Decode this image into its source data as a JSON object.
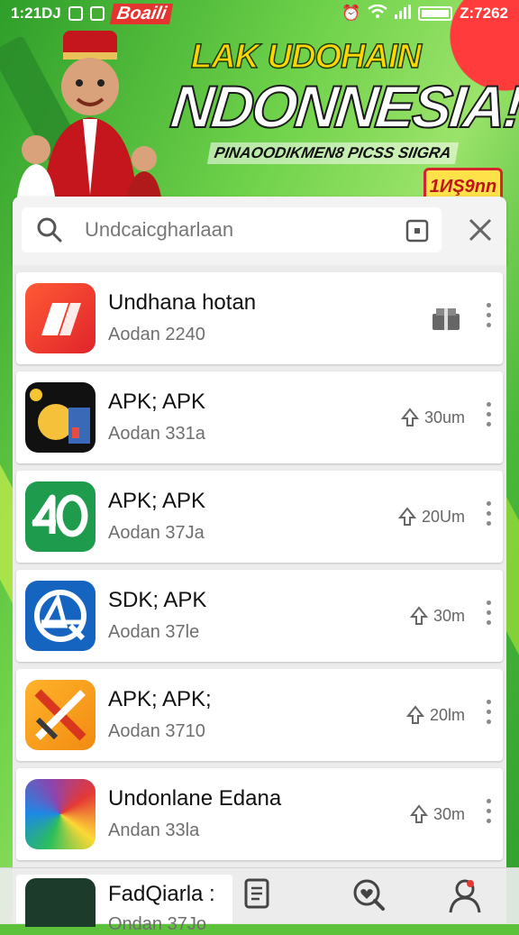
{
  "status_bar": {
    "time_left": "1:21DJ",
    "brand": "Boaili",
    "time_right": "Z:7262"
  },
  "banner": {
    "title_small": "LAK UDOHAIN",
    "title_large": "NDONNESIA!",
    "subtitle": "PINAOODIKMEN8 PICSS SIIGRA",
    "badge": "1ИŞ9nn"
  },
  "search": {
    "placeholder": "Undcaicgharlaan",
    "value": ""
  },
  "apps": [
    {
      "name": "Undhana hotan",
      "subtitle": "Aodan 2240",
      "meta": "",
      "icon": "red-pill-logo",
      "trailing": "gift-icon"
    },
    {
      "name": "APK; APK",
      "subtitle": "Aodan 331a",
      "meta": "30um",
      "icon": "cartoon-app",
      "trailing": "download-icon"
    },
    {
      "name": "APK; APK",
      "subtitle": "Aodan 37Ja",
      "meta": "20Um",
      "icon": "green-40-logo",
      "trailing": "download-icon"
    },
    {
      "name": "SDK; APK",
      "subtitle": "Aodan 37le",
      "meta": "30m",
      "icon": "blue-circle-logo",
      "trailing": "download-icon"
    },
    {
      "name": "APK; APK;",
      "subtitle": "Aodan 3710",
      "meta": "20lm",
      "icon": "orange-x-logo",
      "trailing": "download-icon"
    },
    {
      "name": "Undonlane Edana",
      "subtitle": "Andan 33la",
      "meta": "30m",
      "icon": "rainbow-logo",
      "trailing": "download-icon"
    }
  ],
  "partial_app": {
    "name": "FadQiarla :",
    "subtitle": "Ondan 37Jo"
  },
  "bottom_nav": [
    "document-icon",
    "heart-search-icon",
    "profile-icon"
  ],
  "colors": {
    "accent_green": "#5cc23a",
    "banner_red": "#e3342f",
    "title_yellow": "#ffd400"
  }
}
